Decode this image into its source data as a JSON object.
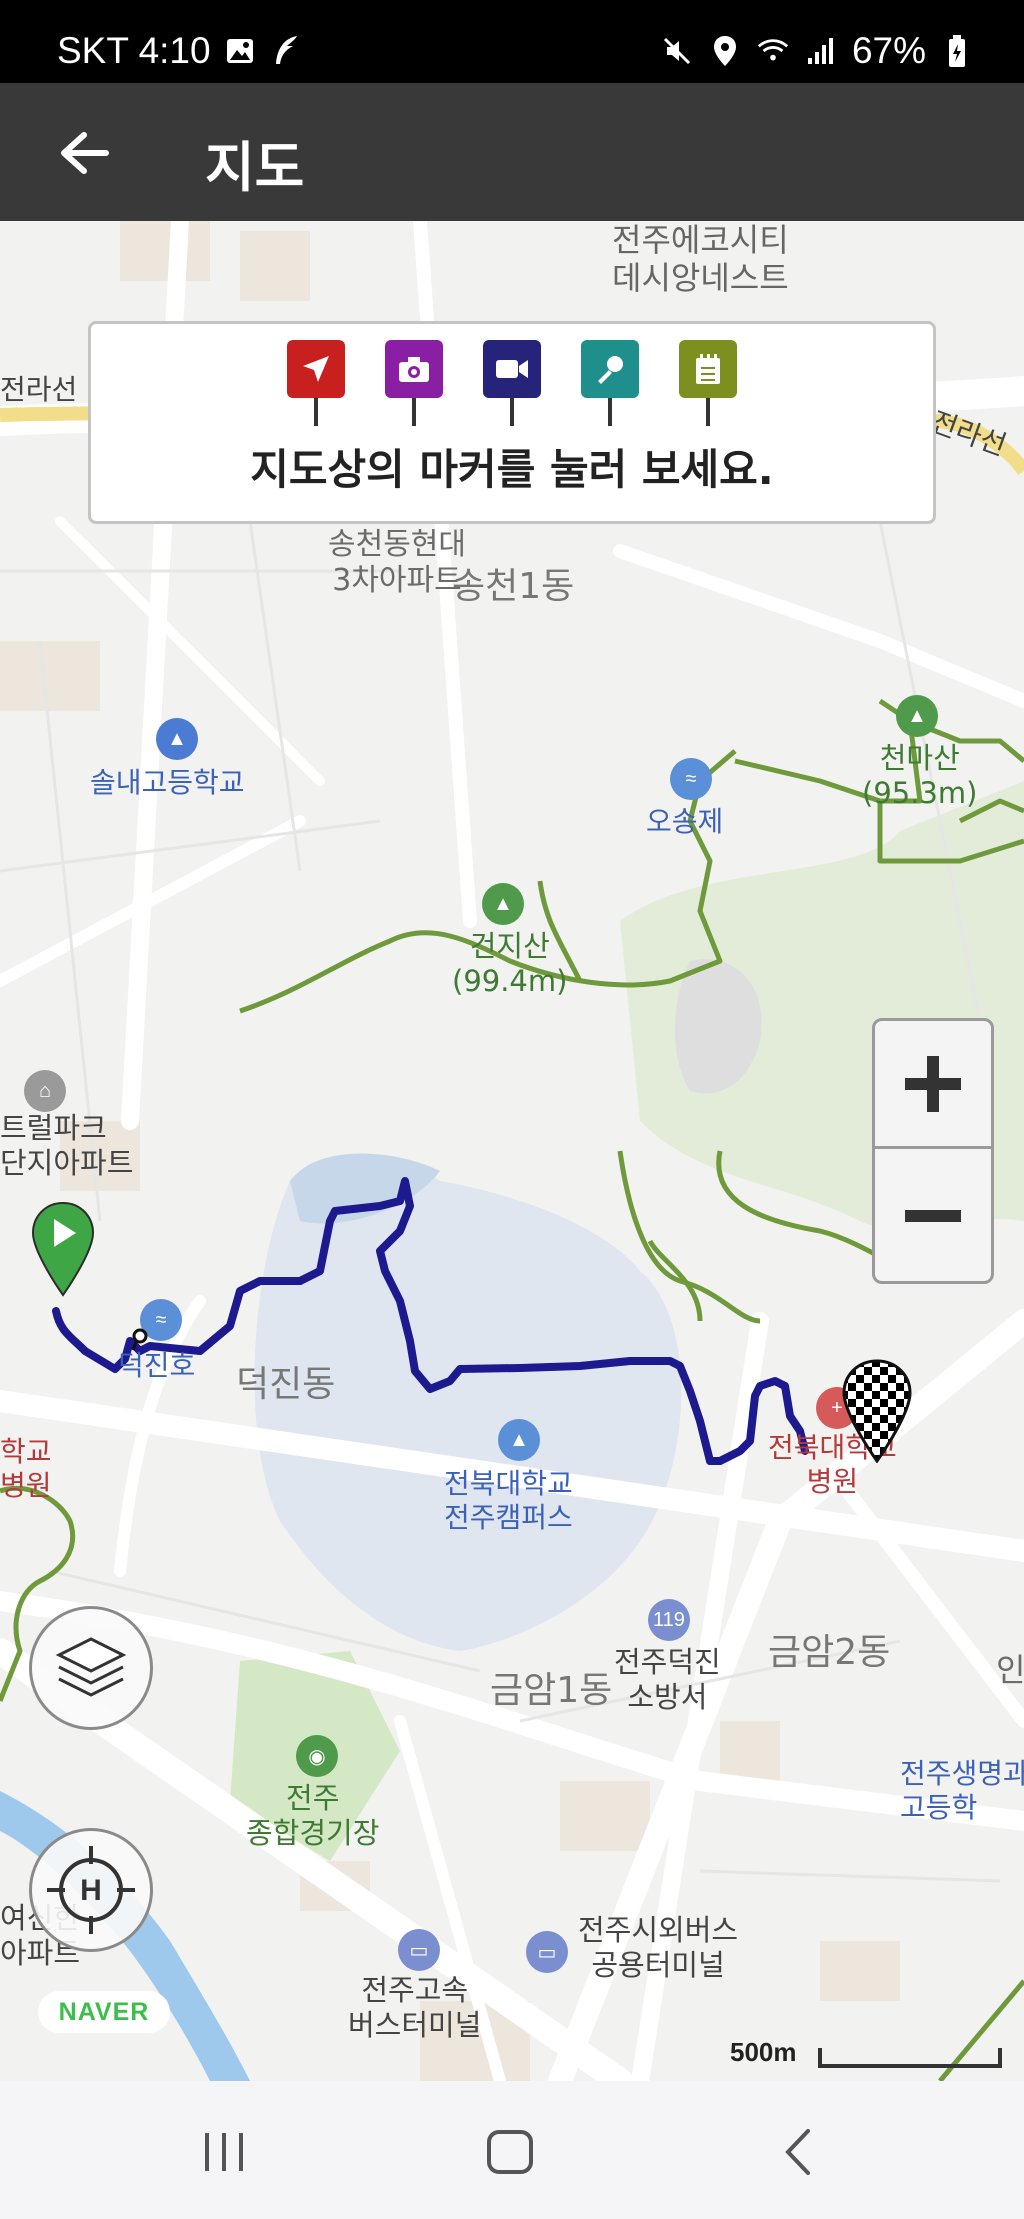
{
  "status_bar": {
    "carrier_time": "SKT 4:10",
    "battery": "67%"
  },
  "header": {
    "title": "지도"
  },
  "legend": {
    "text": "지도상의 마커를 눌러 보세요.",
    "markers": [
      {
        "icon": "navigation-arrow-icon",
        "color": "#c8201f"
      },
      {
        "icon": "camera-icon",
        "color": "#8a1fa3"
      },
      {
        "icon": "video-camera-icon",
        "color": "#26237a"
      },
      {
        "icon": "microphone-icon",
        "color": "#1f8f8c"
      },
      {
        "icon": "notepad-icon",
        "color": "#7d8f1f"
      }
    ]
  },
  "map_labels": {
    "jeonju_ecocity": "전주에코시티\n데시앙네스트",
    "jeolla_line_left": "전라선",
    "jeolla_line_right": "전라선",
    "songcheon_hyundai": "송천동현대\n3차아파트",
    "songcheon1": "송천1동",
    "sollae_school": "솔내고등학교",
    "osongje": "오송제",
    "cheonmasan": "천마산\n(95.3m)",
    "geonjisan": "건지산\n(99.4m)",
    "central_park": "트럴파크\n단지아파트",
    "deokjinho": "덕진호",
    "deokjin_dong": "덕진동",
    "jbnu": "전북대학교\n전주캠퍼스",
    "jbnu_hospital": "전북대학교\n병원",
    "left_hospital": "학교\n병원",
    "deokjin_fire": "전주덕진\n소방서",
    "geumam2": "금암2동",
    "geumam1": "금암1동",
    "jeonju_stadium": "전주\n종합경기장",
    "jeonju_life_school": "전주생명과\n고등학",
    "jeonju_express": "전주고속\n버스터미널",
    "intercity_terminal": "전주시외버스\n공용터미널",
    "left_apt": "여신한\n아파트",
    "edge_right": "인"
  },
  "map_controls": {
    "zoom_in": "+",
    "zoom_out": "−",
    "layers": "layers-icon",
    "locate": "current-location-icon"
  },
  "route": {
    "color": "#1c1a8e",
    "start": "start-flag-icon",
    "end": "finish-checkered-flag-icon"
  },
  "attribution": {
    "logo": "NAVER",
    "scale": "500m"
  },
  "colors": {
    "park_green": "#6f9a3c",
    "water_blue": "#dde6f0",
    "road": "#ffffff"
  }
}
